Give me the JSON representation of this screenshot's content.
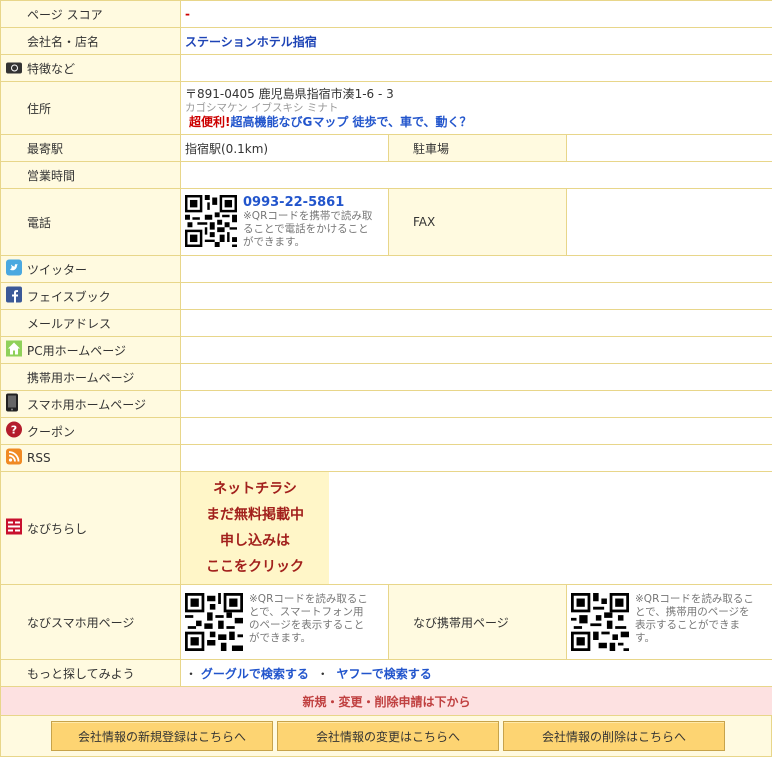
{
  "rows": {
    "score": {
      "label": "ページ スコア",
      "value": "-"
    },
    "name": {
      "label": "会社名・店名",
      "value": "ステーションホテル指宿"
    },
    "features": {
      "label": "特徴など"
    },
    "address": {
      "label": "住所",
      "line1": "〒891-0405 鹿児島県指宿市湊1-6 - 3",
      "kana": "カゴシマケン イブスキシ ミナト",
      "map_prefix": "超便利!",
      "map_link": "超高機能なびGマップ 徒歩で、車で、動く？"
    },
    "station": {
      "label": "最寄駅",
      "value": "指宿駅(0.1km)",
      "parking_label": "駐車場"
    },
    "hours": {
      "label": "営業時間"
    },
    "phone": {
      "label": "電話",
      "number": "0993-22-5861",
      "qr_note": "※QRコードを携帯で読み取ることで電話をかけることができます。",
      "fax_label": "FAX"
    },
    "twitter": {
      "label": "ツイッター"
    },
    "facebook": {
      "label": "フェイスブック"
    },
    "email": {
      "label": "メールアドレス"
    },
    "pc_home": {
      "label": "PC用ホームページ"
    },
    "mobile_home": {
      "label": "携帯用ホームページ"
    },
    "smart_home": {
      "label": "スマホ用ホームページ"
    },
    "coupon": {
      "label": "クーポン"
    },
    "rss": {
      "label": "RSS"
    },
    "navichirashi": {
      "label": "なびちらし",
      "cta_lines": [
        "ネットチラシ",
        "まだ無料掲載中",
        "申し込みは",
        "ここをクリック"
      ]
    },
    "navi_smart": {
      "label": "なびスマホ用ページ",
      "qr_note": "※QRコードを読み取ることで、スマートフォン用のページを表示することができます。",
      "mobile_label": "なび携帯用ページ",
      "mobile_qr_note": "※QRコードを読み取ることで、携帯用のページを表示することができます。"
    },
    "search": {
      "label": "もっと探してみよう",
      "bullet": "・",
      "google": "グーグルで検索する",
      "sep": "・",
      "yahoo": "ヤフーで検索する"
    }
  },
  "notice": "新規・変更・削除申請は下から",
  "buttons": {
    "register": "会社情報の新規登録はこちらへ",
    "change": "会社情報の変更はこちらへ",
    "delete": "会社情報の削除はこちらへ"
  },
  "icons": [
    "camera-icon",
    "twitter-icon",
    "facebook-icon",
    "home-icon",
    "smartphone-icon",
    "coupon-icon",
    "rss-icon",
    "chirashi-icon"
  ]
}
